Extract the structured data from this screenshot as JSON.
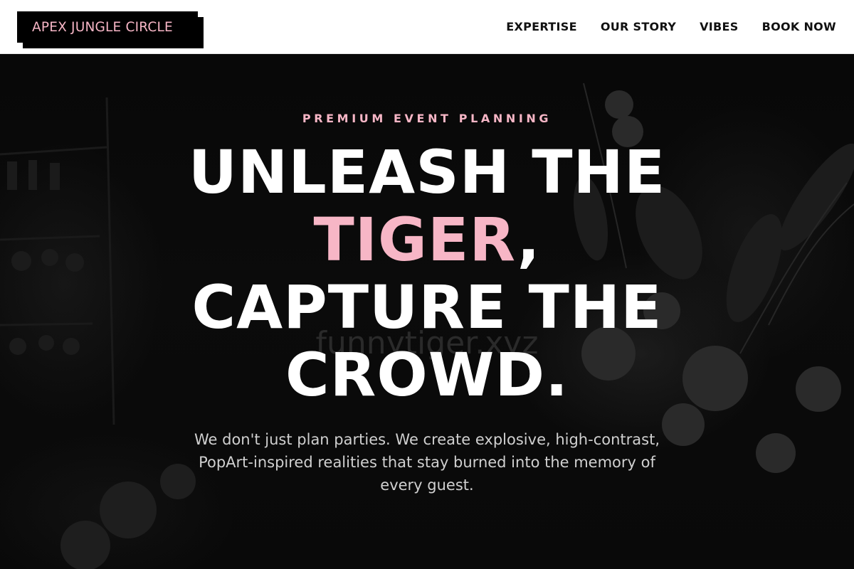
{
  "header": {
    "logo": "APEX JUNGLE CIRCLE",
    "nav": [
      {
        "label": "EXPERTISE"
      },
      {
        "label": "OUR STORY"
      },
      {
        "label": "VIBES"
      },
      {
        "label": "BOOK NOW"
      }
    ]
  },
  "hero": {
    "eyebrow": "PREMIUM EVENT PLANNING",
    "headline_line1": "UNLEASH THE",
    "headline_accent": "TIGER",
    "headline_comma": ",",
    "headline_line3": "CAPTURE THE",
    "headline_line4": "CROWD.",
    "lead": "We don't just plan parties. We create explosive, high-contrast, PopArt-inspired realities that stay burned into the memory of every guest.",
    "watermark": "funnytiger.xyz"
  },
  "colors": {
    "accent": "#f7b6c6",
    "header_bg": "#ffffff",
    "hero_bg": "#0a0a0a",
    "headline": "#ffffff"
  }
}
